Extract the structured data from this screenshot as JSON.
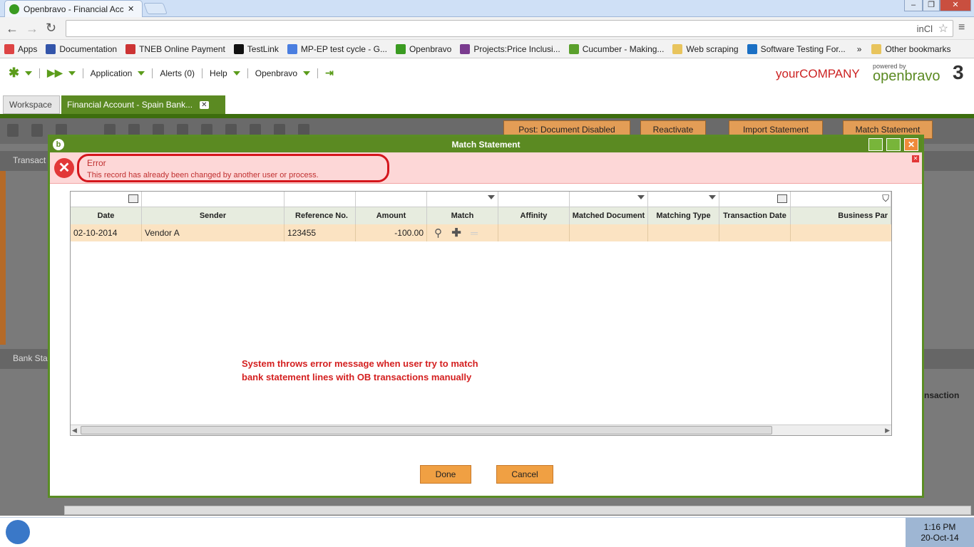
{
  "browser": {
    "tab_title": "Openbravo - Financial Acc",
    "url_tail": "inCl",
    "bookmarks": [
      {
        "label": "Apps",
        "color": "#d44"
      },
      {
        "label": "Documentation",
        "color": "#35a"
      },
      {
        "label": "TNEB Online Payment",
        "color": "#c33"
      },
      {
        "label": "TestLink",
        "color": "#111"
      },
      {
        "label": "MP-EP test cycle - G...",
        "color": "#4a7ee0"
      },
      {
        "label": "Openbravo",
        "color": "#3a9b21"
      },
      {
        "label": "Projects:Price Inclusi...",
        "color": "#7a3b8f"
      },
      {
        "label": "Cucumber - Making...",
        "color": "#5aa02c"
      },
      {
        "label": "Web scraping",
        "color": "#e8c45d"
      },
      {
        "label": "Software Testing For...",
        "color": "#1a6fc4"
      }
    ],
    "overflow": "»",
    "other_bookmarks": "Other bookmarks"
  },
  "ob": {
    "menu": {
      "application": "Application",
      "alerts": "Alerts (0)",
      "help": "Help",
      "openbravo": "Openbravo"
    },
    "logo_company": "yourCOMPANY",
    "logo_powered": "powered by",
    "logo_brand": "openbravo",
    "tabs": {
      "workspace": "Workspace",
      "financial": "Financial Account - Spain Bank...",
      "close": "✕"
    },
    "toolbar_buttons": {
      "post": "Post: Document Disabled",
      "reactivate": "Reactivate",
      "import": "Import Statement",
      "match": "Match Statement"
    },
    "bg_labels": {
      "transactions": "Transact",
      "bank_statements": "Bank Sta",
      "transaction": "nsaction"
    }
  },
  "modal": {
    "title": "Match Statement",
    "error_title": "Error",
    "error_message": "This record has already been changed by another user or process.",
    "columns": [
      "Date",
      "Sender",
      "Reference No.",
      "Amount",
      "Match",
      "Affinity",
      "Matched Document",
      "Matching Type",
      "Transaction Date",
      "Business Par"
    ],
    "row": {
      "date": "02-10-2014",
      "sender": "Vendor A",
      "reference": "123455",
      "amount": "-100.00"
    },
    "annotation_line1": "System throws error message when user try to match",
    "annotation_line2": "bank statement lines with OB transactions manually",
    "done": "Done",
    "cancel": "Cancel"
  },
  "taskbar": {
    "time": "1:16 PM",
    "date": "20-Oct-14"
  },
  "colors": {
    "ob_green": "#5b8a22",
    "error_bg": "#fdd7d7",
    "row_highlight": "#fbe3c2",
    "button_orange": "#f0a043"
  }
}
